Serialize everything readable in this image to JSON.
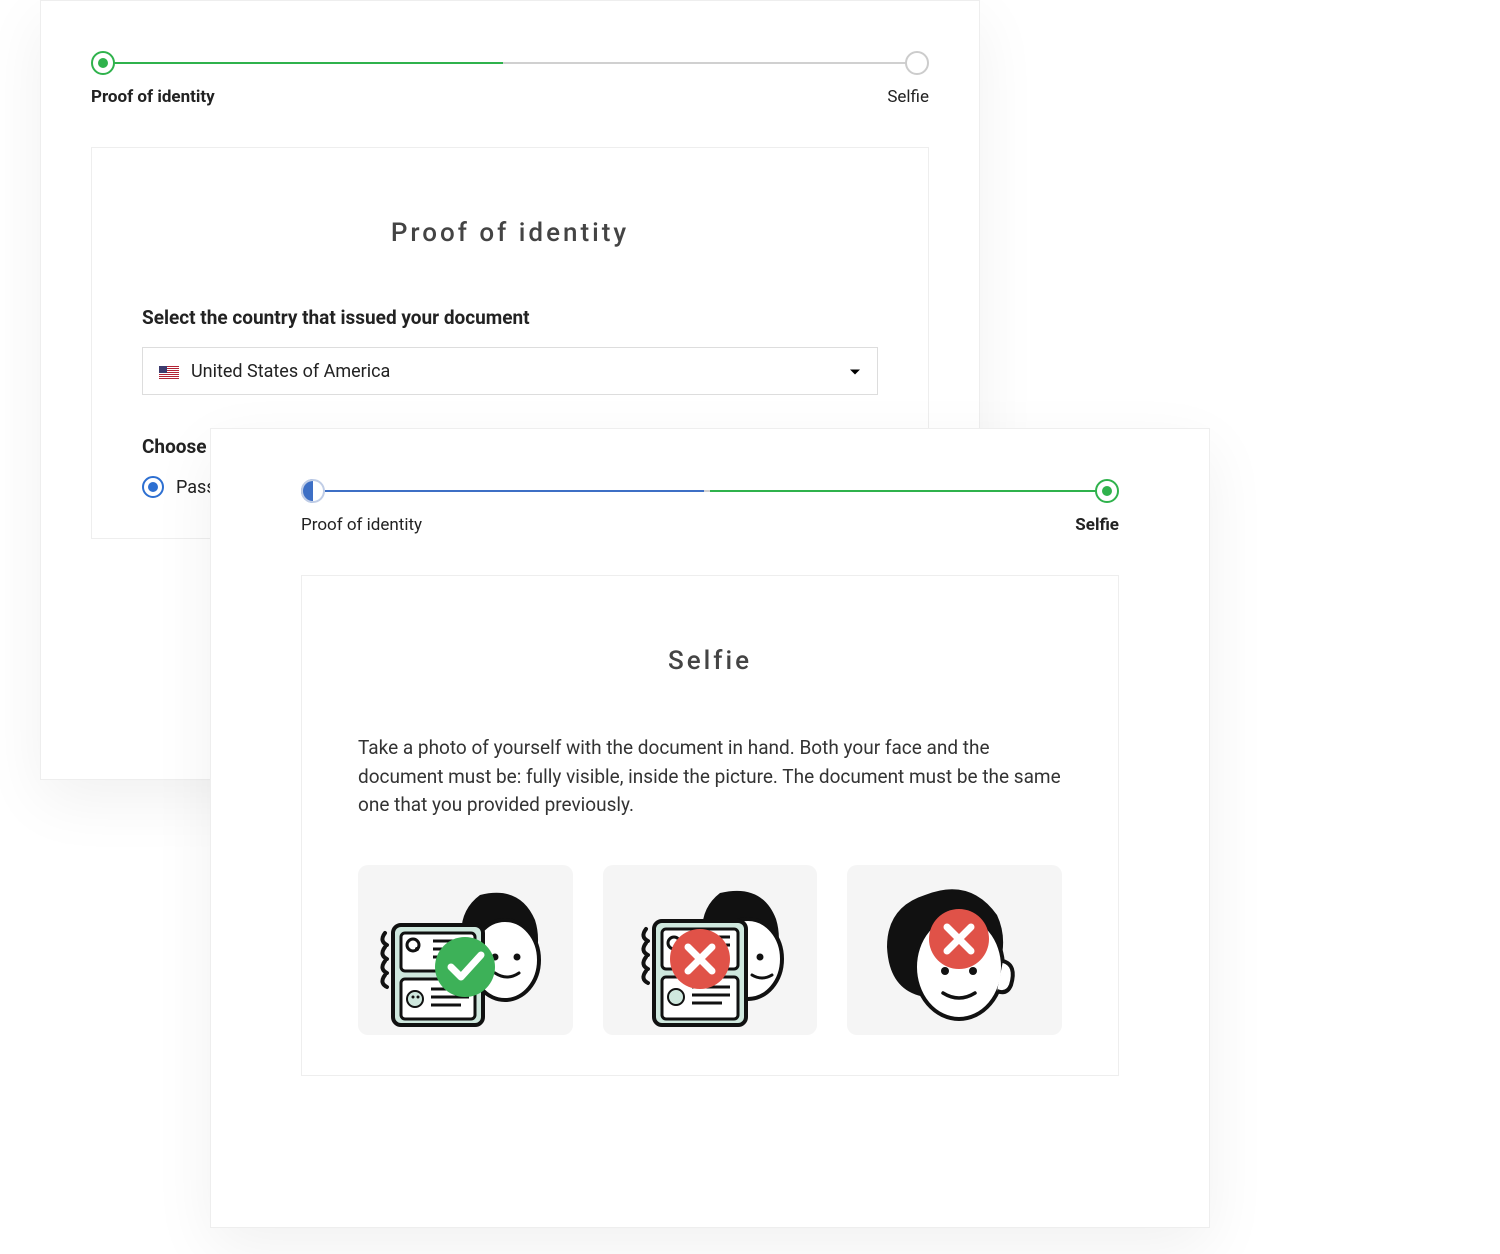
{
  "colors": {
    "green": "#2fb24c",
    "blue": "#3d6fc5",
    "red": "#e05248"
  },
  "step1": {
    "progress": {
      "label_left": "Proof of identity",
      "label_right": "Selfie"
    },
    "title": "Proof of identity",
    "country_label": "Select the country that issued your document",
    "country_value": "United States of America",
    "id_type_label": "Choose your ID type",
    "id_options": [
      {
        "label": "Passport",
        "selected": true
      }
    ]
  },
  "step2": {
    "progress": {
      "label_left": "Proof of identity",
      "label_right": "Selfie"
    },
    "title": "Selfie",
    "instructions": "Take a photo of yourself with the document in hand. Both your face and the document must be: fully visible, inside the picture. The document must be the same one that you provided previously.",
    "examples": [
      {
        "status": "correct",
        "desc": "selfie-with-document-good",
        "icon": "check"
      },
      {
        "status": "incorrect",
        "desc": "selfie-document-covers-face",
        "icon": "cross"
      },
      {
        "status": "incorrect",
        "desc": "selfie-no-document",
        "icon": "cross"
      }
    ]
  }
}
